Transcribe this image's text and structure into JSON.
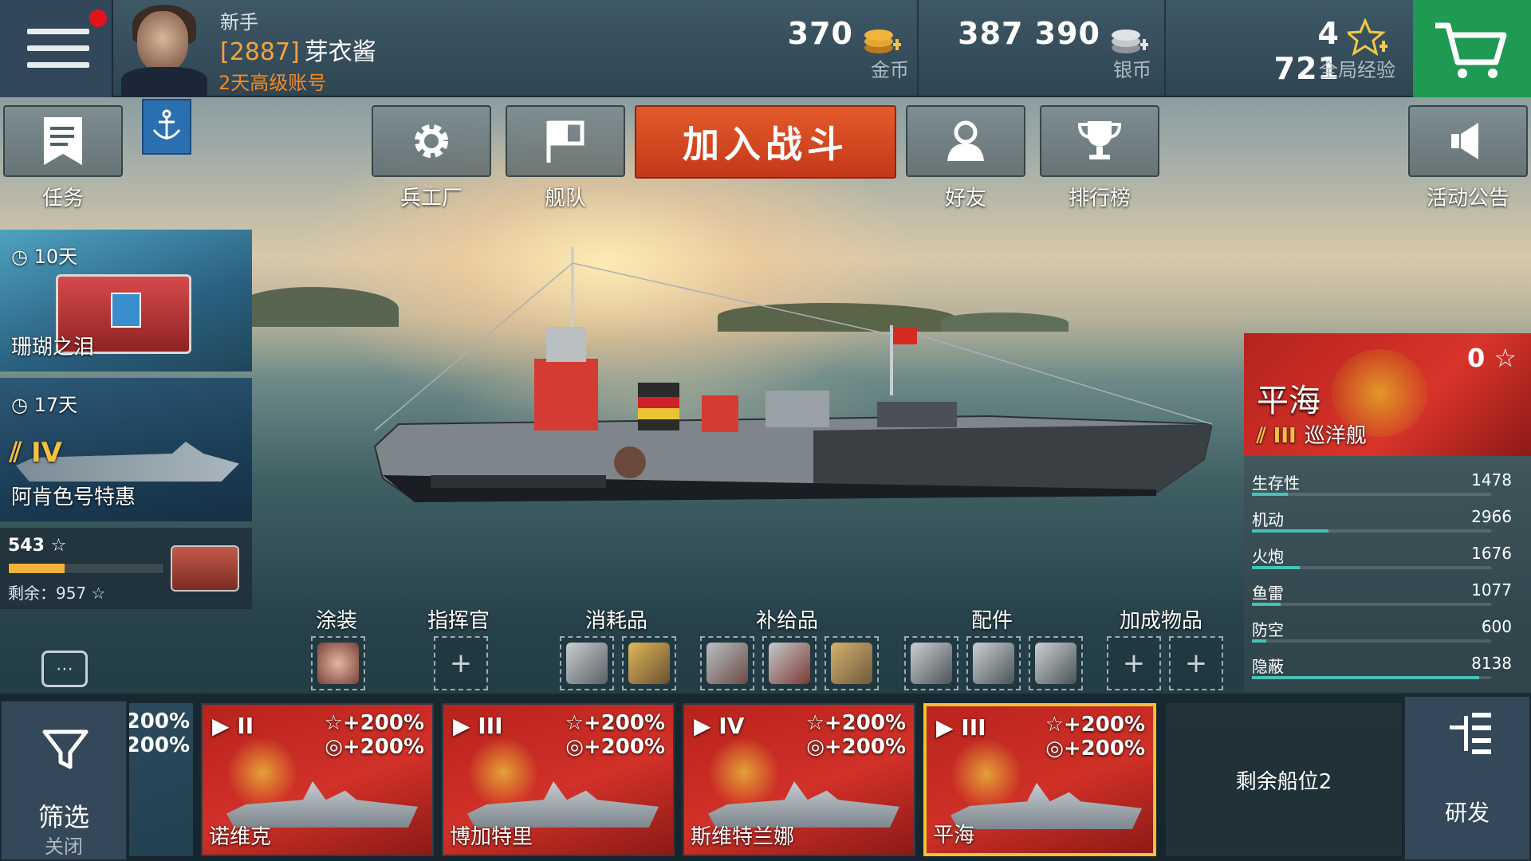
{
  "player": {
    "rank": "新手",
    "clan_tag": "[2887]",
    "name": "芽衣酱",
    "premium_status": "2天高级账号"
  },
  "currencies": [
    {
      "amount": "370",
      "label": "金币",
      "color": "#f2b43a"
    },
    {
      "amount": "387 390",
      "label": "银币",
      "color": "#d4d9dc"
    },
    {
      "amount": "4 721",
      "label": "全局经验",
      "color": "#f0c94a"
    }
  ],
  "nav": {
    "missions": "任务",
    "armory": "兵工厂",
    "fleet": "舰队",
    "battle": "加入战斗",
    "friends": "好友",
    "leaderboard": "排行榜",
    "announcements": "活动公告"
  },
  "promos": [
    {
      "timer": "10天",
      "title": "珊瑚之泪"
    },
    {
      "timer": "17天",
      "tier": "IV",
      "title": "阿肯色号特惠"
    }
  ],
  "xp_progress": {
    "value": "543",
    "remaining": "剩余：957",
    "fraction": 0.36
  },
  "equipment": {
    "camouflage": "涂装",
    "commander": "指挥官",
    "consumables": "消耗品",
    "supplies": "补给品",
    "modules": "配件",
    "boosters": "加成物品"
  },
  "ship_info": {
    "name": "平海",
    "tier": "III",
    "class": "巡洋舰",
    "xp": "0",
    "stats": [
      {
        "name": "生存性",
        "value": "1478",
        "fraction": 0.15
      },
      {
        "name": "机动",
        "value": "2966",
        "fraction": 0.32
      },
      {
        "name": "火炮",
        "value": "1676",
        "fraction": 0.2
      },
      {
        "name": "鱼雷",
        "value": "1077",
        "fraction": 0.12
      },
      {
        "name": "防空",
        "value": "600",
        "fraction": 0.06
      },
      {
        "name": "隐蔽",
        "value": "8138",
        "fraction": 0.95
      }
    ]
  },
  "carousel": {
    "filter_label": "筛选",
    "filter_state": "关闭",
    "partial_bonus_1": "+200%",
    "partial_bonus_2": "+200%",
    "ships": [
      {
        "tier": "II",
        "name": "诺维克",
        "bonus_xp": "+200%",
        "bonus_credits": "+200%",
        "selected": false
      },
      {
        "tier": "III",
        "name": "博加特里",
        "bonus_xp": "+200%",
        "bonus_credits": "+200%",
        "selected": false
      },
      {
        "tier": "IV",
        "name": "斯维特兰娜",
        "bonus_xp": "+200%",
        "bonus_credits": "+200%",
        "selected": false
      },
      {
        "tier": "III",
        "name": "平海",
        "bonus_xp": "+200%",
        "bonus_credits": "+200%",
        "selected": true
      }
    ],
    "slots_remaining": "剩余船位2",
    "research": "研发"
  }
}
